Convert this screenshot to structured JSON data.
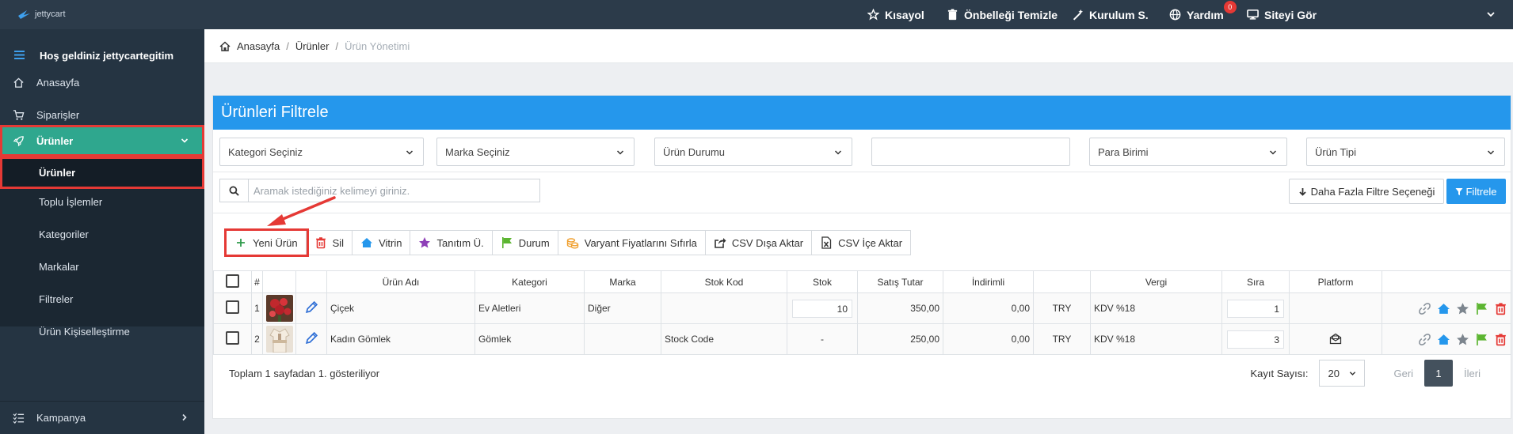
{
  "app": {
    "logo_text": "jettycart"
  },
  "topbar": {
    "items": [
      {
        "label": "Kısayol",
        "icon": "star-icon"
      },
      {
        "label": "Önbelleği Temizle",
        "icon": "trash-icon"
      },
      {
        "label": "Kurulum S.",
        "icon": "magic-wand-icon"
      },
      {
        "label": "Yardım",
        "icon": "globe-icon",
        "badge": "0"
      },
      {
        "label": "Siteyi Gör",
        "icon": "monitor-icon"
      }
    ]
  },
  "sidebar": {
    "welcome": "Hoş geldiniz jettycartegitim",
    "items": [
      {
        "label": "Anasayfa",
        "icon": "home-icon"
      },
      {
        "label": "Siparişler",
        "icon": "cart-icon"
      },
      {
        "label": "Ürünler",
        "icon": "rocket-icon",
        "active": true
      },
      {
        "label": "Kampanya",
        "icon": "list-icon"
      }
    ],
    "sub_items": [
      {
        "label": "Ürünler",
        "current": true
      },
      {
        "label": "Toplu İşlemler"
      },
      {
        "label": "Kategoriler"
      },
      {
        "label": "Markalar"
      },
      {
        "label": "Filtreler"
      },
      {
        "label": "Ürün Kişiselleştirme"
      }
    ]
  },
  "breadcrumb": {
    "home": "Anasayfa",
    "section": "Ürünler",
    "current": "Ürün Yönetimi",
    "sep": "/"
  },
  "filter": {
    "title": "Ürünleri Filtrele",
    "selects": [
      {
        "value": "Kategori Seçiniz"
      },
      {
        "value": "Marka Seçiniz"
      },
      {
        "value": "Ürün Durumu"
      },
      {
        "value": ""
      },
      {
        "value": "Para Birimi"
      },
      {
        "value": "Ürün Tipi"
      }
    ],
    "search_placeholder": "Aramak istediğiniz kelimeyi giriniz.",
    "more_filters": "Daha Fazla Filtre Seçeneği",
    "filter_button": "Filtrele"
  },
  "toolbar": {
    "buttons": [
      {
        "label": "Yeni Ürün",
        "icon": "plus-icon",
        "color": "#2e9b4b"
      },
      {
        "label": "Sil",
        "icon": "trash-icon",
        "color": "#e53935"
      },
      {
        "label": "Vitrin",
        "icon": "home-icon",
        "color": "#2597ec"
      },
      {
        "label": "Tanıtım Ü.",
        "icon": "star-icon",
        "color": "#8e3fb8"
      },
      {
        "label": "Durum",
        "icon": "flag-icon",
        "color": "#5cb531"
      },
      {
        "label": "Varyant Fiyatlarını Sıfırla",
        "icon": "coins-icon",
        "color": "#f0a030"
      },
      {
        "label": "CSV Dışa Aktar",
        "icon": "export-icon",
        "color": "#333333"
      },
      {
        "label": "CSV İçe Aktar",
        "icon": "file-excel-icon",
        "color": "#333333"
      }
    ]
  },
  "table": {
    "headers": [
      "#",
      "Ürün Adı",
      "Kategori",
      "Marka",
      "Stok Kod",
      "Stok",
      "Satış Tutar",
      "İndirimli",
      "Vergi",
      "Sıra",
      "Platform"
    ],
    "rows": [
      {
        "num": "1",
        "name": "Çiçek",
        "category": "Ev Aletleri",
        "brand": "Diğer",
        "stock_code": "",
        "stock": "10",
        "price": "350,00",
        "discounted": "0,00",
        "currency": "TRY",
        "tax": "KDV %18",
        "order": "1",
        "platform": ""
      },
      {
        "num": "2",
        "name": "Kadın Gömlek",
        "category": "Gömlek",
        "brand": "",
        "stock_code": "Stock Code",
        "stock": "-",
        "price": "250,00",
        "discounted": "0,00",
        "currency": "TRY",
        "tax": "KDV %18",
        "order": "3",
        "platform": "envelope-open-icon"
      }
    ]
  },
  "footer": {
    "info": "Toplam 1 sayfadan 1. gösteriliyor",
    "page_size_label": "Kayıt Sayısı:",
    "page_size": "20",
    "prev": "Geri",
    "page": "1",
    "next": "İleri"
  }
}
